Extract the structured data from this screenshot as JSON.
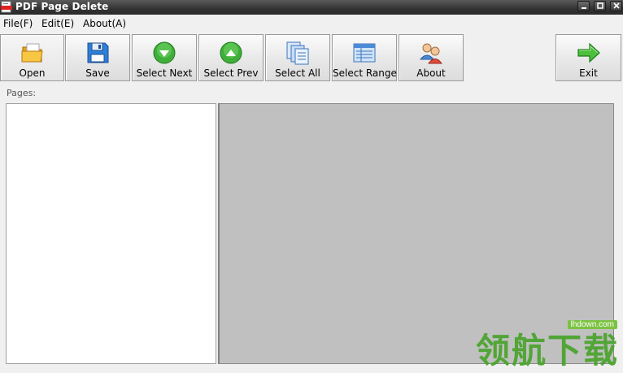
{
  "window": {
    "title": "PDF Page Delete"
  },
  "menu": {
    "items": [
      {
        "label": "File(F)"
      },
      {
        "label": "Edit(E)"
      },
      {
        "label": "About(A)"
      }
    ]
  },
  "toolbar": {
    "buttons": [
      {
        "label": "Open",
        "icon": "folder-open-icon"
      },
      {
        "label": "Save",
        "icon": "floppy-disk-icon"
      },
      {
        "label": "Select Next",
        "icon": "green-arrow-down-icon"
      },
      {
        "label": "Select Prev",
        "icon": "green-arrow-up-icon"
      },
      {
        "label": "Select All",
        "icon": "stacked-pages-icon"
      },
      {
        "label": "Select Range",
        "icon": "page-range-icon"
      },
      {
        "label": "About",
        "icon": "users-icon"
      },
      {
        "label": "Exit",
        "icon": "green-arrow-right-icon"
      }
    ]
  },
  "pages": {
    "label": "Pages:"
  },
  "watermark": {
    "url": "lhdown.com",
    "text": "领航下载"
  },
  "colors": {
    "titlebar": "#3a3a3a",
    "preview_background": "#c0c0c0",
    "watermark_green": "#49a32c"
  }
}
